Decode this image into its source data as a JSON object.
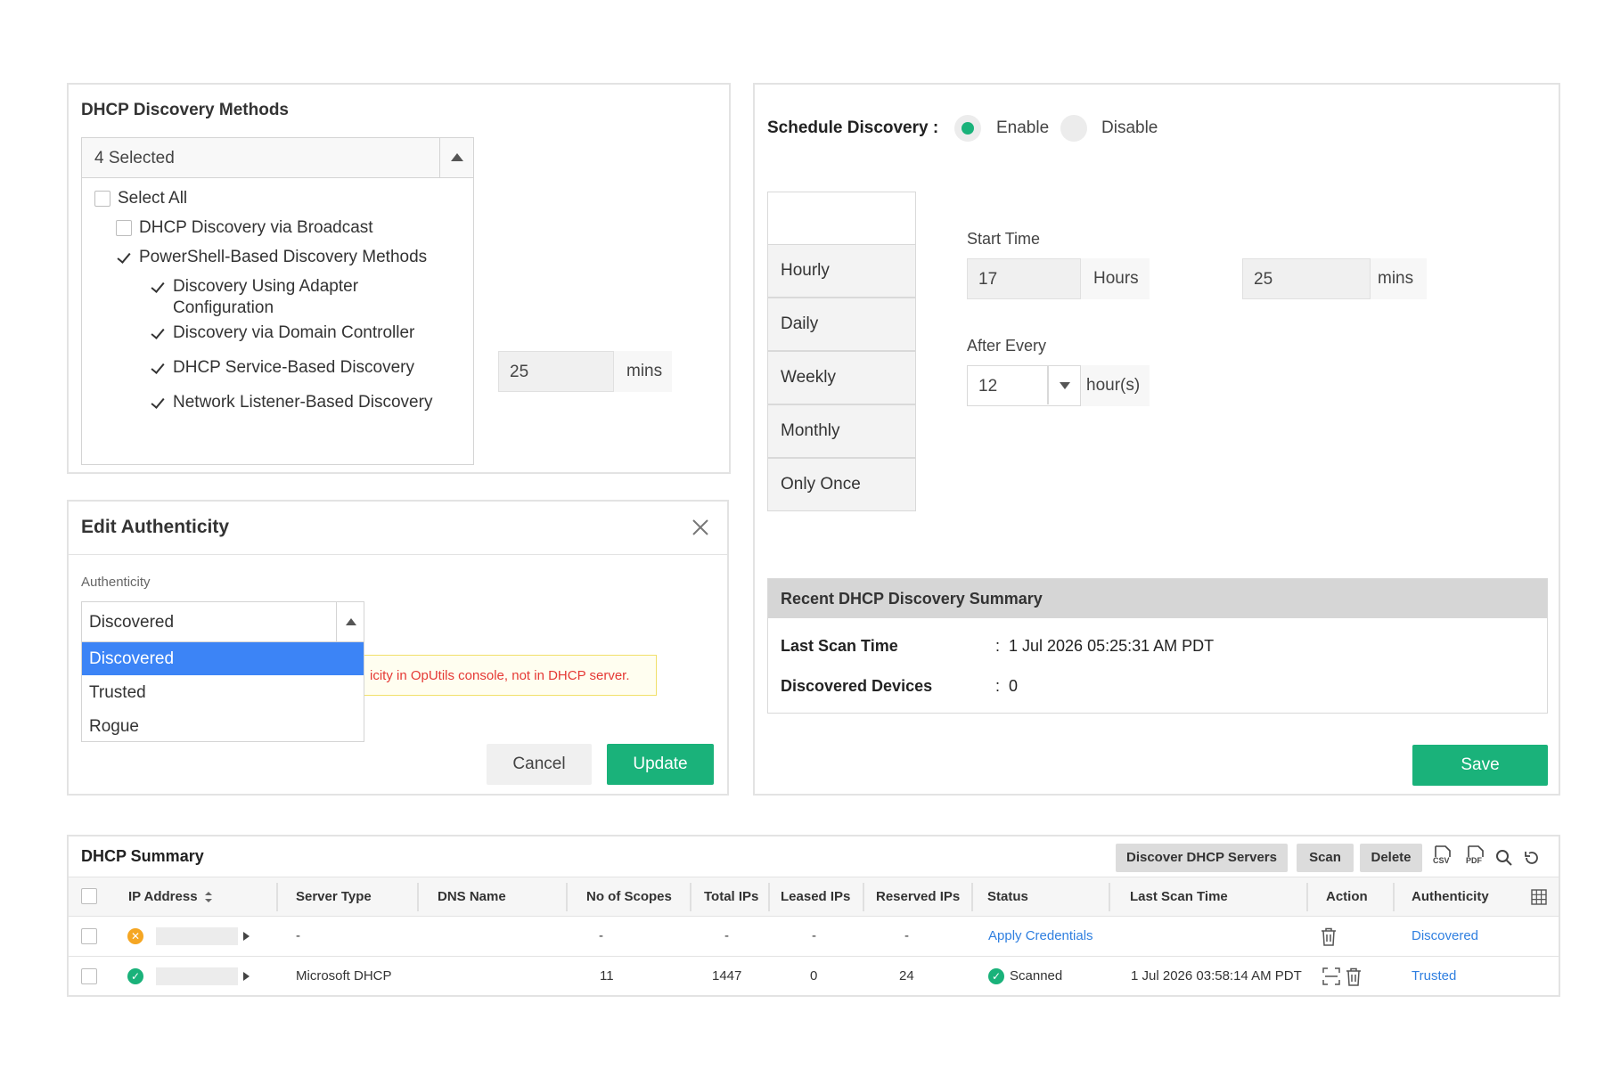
{
  "discovery_methods": {
    "title": "DHCP Discovery Methods",
    "selected_summary": "4 Selected",
    "select_all": "Select All",
    "options": [
      {
        "label": "DHCP Discovery via Broadcast",
        "checked": false
      },
      {
        "label": "PowerShell-Based Discovery Methods",
        "checked": true
      },
      {
        "label": "Discovery Using Adapter Configuration",
        "checked": true
      },
      {
        "label": "Discovery via Domain Controller",
        "checked": true
      },
      {
        "label": "DHCP Service-Based Discovery",
        "checked": true
      },
      {
        "label": "Network Listener-Based Discovery",
        "checked": true
      }
    ],
    "interval_value": "25",
    "interval_unit": "mins"
  },
  "schedule": {
    "label": "Schedule Discovery :",
    "enable_label": "Enable",
    "disable_label": "Disable",
    "enabled": true,
    "frequencies": [
      "Hourly",
      "Daily",
      "Weekly",
      "Monthly",
      "Only Once"
    ],
    "start_time_label": "Start Time",
    "start_hours": "17",
    "hours_unit": "Hours",
    "start_mins": "25",
    "mins_unit": "mins",
    "after_every_label": "After Every",
    "after_every_value": "12",
    "after_every_unit": "hour(s)"
  },
  "recent_summary": {
    "title": "Recent DHCP Discovery Summary",
    "last_scan_label": "Last Scan Time",
    "last_scan_value": "1 Jul 2026 05:25:31 AM PDT",
    "devices_label": "Discovered Devices",
    "devices_value": "0",
    "separator": ":",
    "save_label": "Save"
  },
  "edit_authenticity": {
    "title": "Edit Authenticity",
    "field_label": "Authenticity",
    "selected": "Discovered",
    "options": [
      "Discovered",
      "Trusted",
      "Rogue"
    ],
    "warning_text": "icity in OpUtils console, not in DHCP server.",
    "cancel_label": "Cancel",
    "update_label": "Update"
  },
  "dhcp_summary": {
    "title": "DHCP Summary",
    "toolbar": {
      "discover_label": "Discover DHCP Servers",
      "scan_label": "Scan",
      "delete_label": "Delete",
      "csv_label": "CSV",
      "pdf_label": "PDF"
    },
    "columns": [
      "IP Address",
      "Server Type",
      "DNS Name",
      "No of Scopes",
      "Total IPs",
      "Leased IPs",
      "Reserved IPs",
      "Status",
      "Last Scan Time",
      "Action",
      "Authenticity"
    ],
    "rows": [
      {
        "status_icon": "warning-icon",
        "server_type": "-",
        "dns_name": "",
        "scopes": "-",
        "total_ips": "-",
        "leased_ips": "-",
        "reserved_ips": "-",
        "status": "Apply Credentials",
        "last_scan": "",
        "authenticity": "Discovered"
      },
      {
        "status_icon": "success-icon",
        "server_type": "Microsoft DHCP",
        "dns_name": "",
        "scopes": "11",
        "total_ips": "1447",
        "leased_ips": "0",
        "reserved_ips": "24",
        "status": "Scanned",
        "last_scan": "1 Jul 2026 03:58:14 AM PDT",
        "authenticity": "Trusted"
      }
    ],
    "colors": {
      "green": "#1ab27a",
      "orange": "#f5a623",
      "link": "#2f7fe0"
    }
  }
}
